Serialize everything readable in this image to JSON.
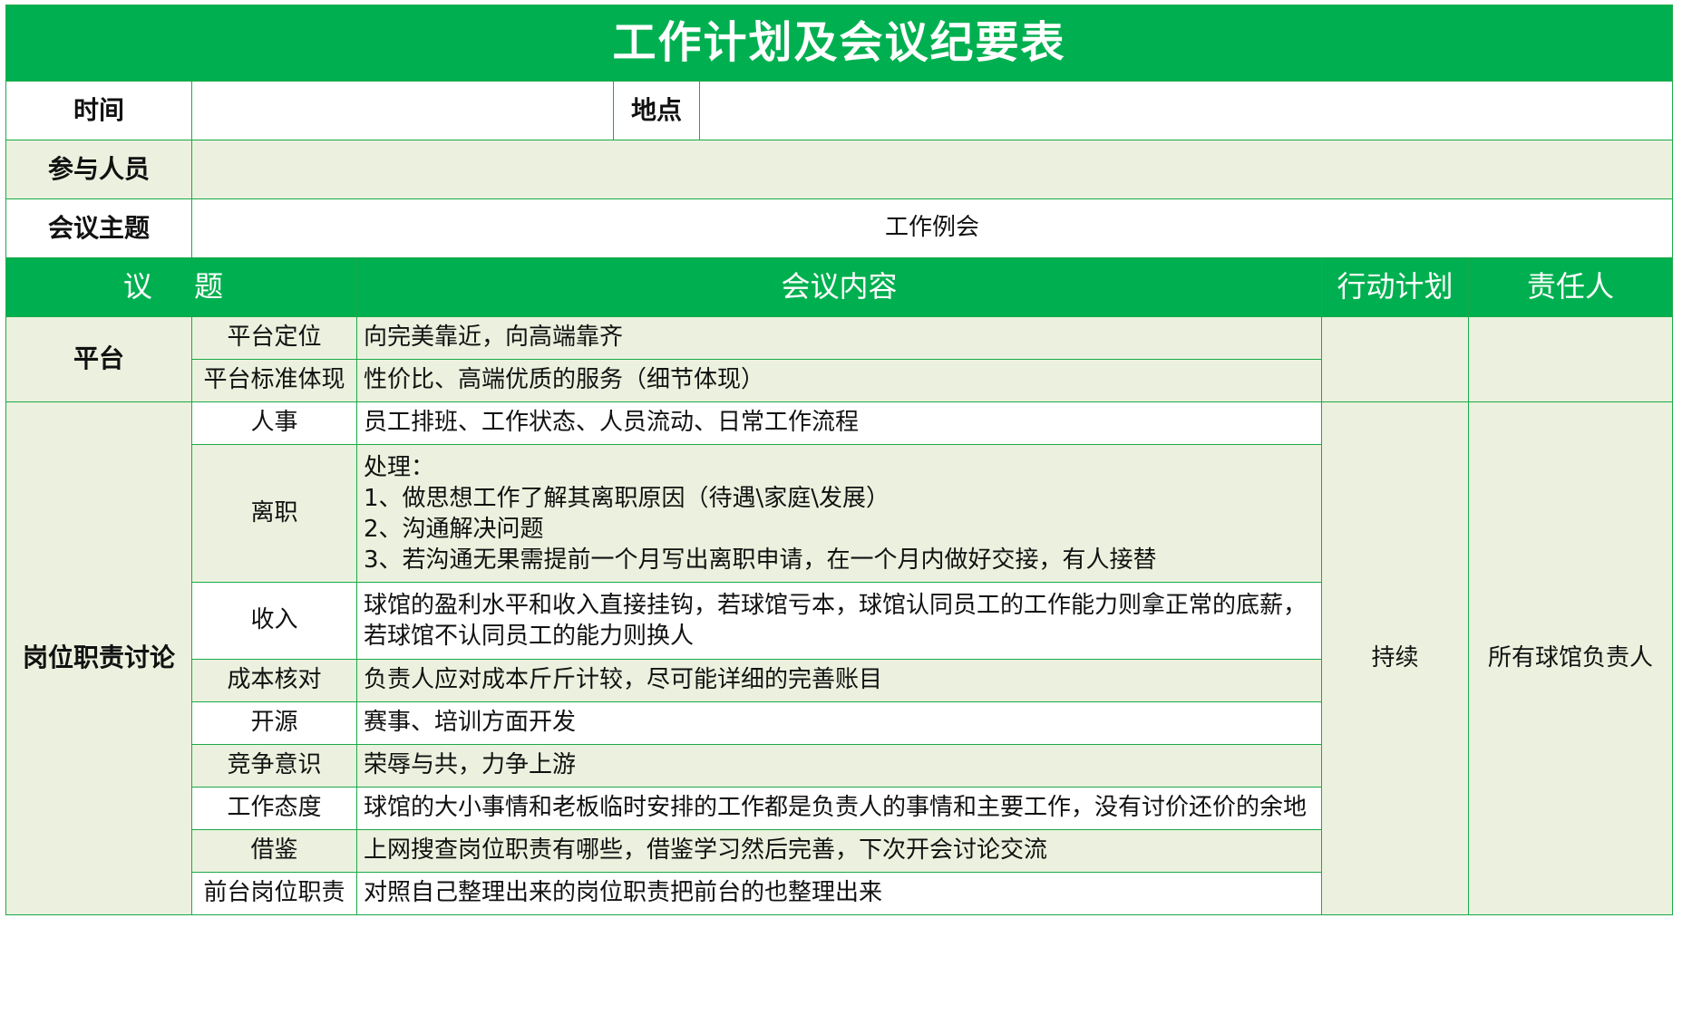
{
  "title": "工作计划及会议纪要表",
  "meta": {
    "time_label": "时间",
    "time_value": "",
    "place_label": "地点",
    "place_value": "",
    "attendees_label": "参与人员",
    "attendees_value": "",
    "topic_label": "会议主题",
    "topic_value": "工作例会"
  },
  "headers": {
    "agenda": "议 题",
    "content": "会议内容",
    "action": "行动计划",
    "owner": "责任人"
  },
  "groups": [
    {
      "name": "平台",
      "rows": [
        {
          "item": "平台定位",
          "content": [
            "向完美靠近，向高端靠齐"
          ]
        },
        {
          "item": "平台标准体现",
          "content": [
            "性价比、高端优质的服务（细节体现）"
          ]
        }
      ]
    },
    {
      "name": "岗位职责讨论",
      "rows": [
        {
          "item": "人事",
          "content": [
            "员工排班、工作状态、人员流动、日常工作流程"
          ]
        },
        {
          "item": "离职",
          "content": [
            "处理：",
            "1、做思想工作了解其离职原因（待遇\\家庭\\发展）",
            "2、沟通解决问题",
            "3、若沟通无果需提前一个月写出离职申请，在一个月内做好交接，有人接替"
          ]
        },
        {
          "item": "收入",
          "content": [
            "球馆的盈利水平和收入直接挂钩，若球馆亏本，球馆认同员工的工作能力则拿正常的底薪，",
            "若球馆不认同员工的能力则换人"
          ]
        },
        {
          "item": "成本核对",
          "content": [
            "负责人应对成本斤斤计较，尽可能详细的完善账目"
          ]
        },
        {
          "item": "开源",
          "content": [
            "赛事、培训方面开发"
          ]
        },
        {
          "item": "竞争意识",
          "content": [
            "荣辱与共，力争上游"
          ]
        },
        {
          "item": "工作态度",
          "content": [
            "球馆的大小事情和老板临时安排的工作都是负责人的事情和主要工作，没有讨价还价的余地"
          ]
        },
        {
          "item": "借鉴",
          "content": [
            "上网搜查岗位职责有哪些，借鉴学习然后完善，下次开会讨论交流"
          ]
        },
        {
          "item": "前台岗位职责",
          "content": [
            "对照自己整理出来的岗位职责把前台的也整理出来"
          ]
        }
      ]
    }
  ],
  "action_plan": "持续",
  "responsible": "所有球馆负责人",
  "colors": {
    "header_green": "#00b050",
    "row_tint": "#ebf1de",
    "border": "#1aaa48"
  }
}
